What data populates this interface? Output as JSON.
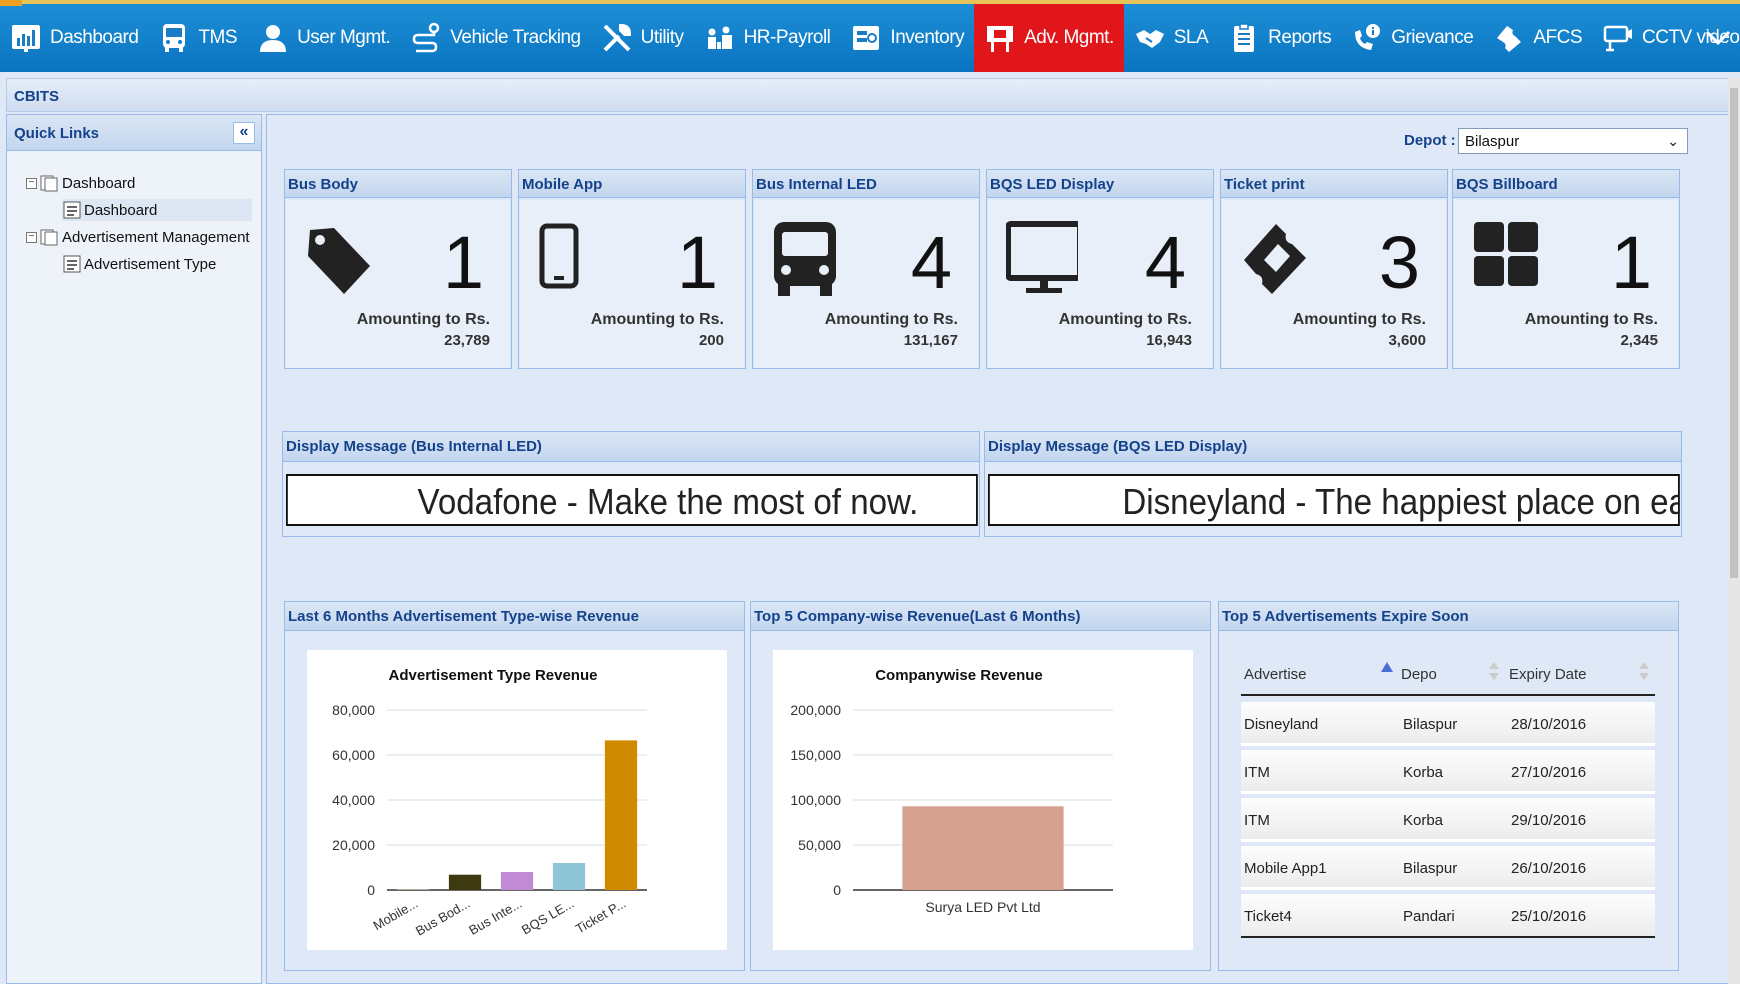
{
  "nav": [
    {
      "label": "Dashboard",
      "icon": "chart-icon"
    },
    {
      "label": "TMS",
      "icon": "bus-icon"
    },
    {
      "label": "User Mgmt.",
      "icon": "user-icon"
    },
    {
      "label": "Vehicle Tracking",
      "icon": "route-icon"
    },
    {
      "label": "Utility",
      "icon": "tools-icon"
    },
    {
      "label": "HR-Payroll",
      "icon": "people-icon"
    },
    {
      "label": "Inventory",
      "icon": "inventory-icon"
    },
    {
      "label": "Adv. Mgmt.",
      "icon": "billboard-icon"
    },
    {
      "label": "SLA",
      "icon": "handshake-icon"
    },
    {
      "label": "Reports",
      "icon": "clipboard-icon"
    },
    {
      "label": "Grievance",
      "icon": "phone-info-icon"
    },
    {
      "label": "AFCS",
      "icon": "ticket-icon"
    },
    {
      "label": "CCTV video",
      "icon": "cctv-icon"
    }
  ],
  "active_nav": "Adv. Mgmt.",
  "breadcrumb": "CBITS",
  "sidebar": {
    "title": "Quick Links",
    "tree": [
      {
        "label": "Dashboard",
        "children": [
          "Dashboard"
        ]
      },
      {
        "label": "Advertisement Management",
        "children": [
          "Advertisement Type"
        ]
      }
    ]
  },
  "depot": {
    "label": "Depot :",
    "value": "Bilaspur"
  },
  "cards": [
    {
      "title": "Bus Body",
      "icon": "tag-icon",
      "count": "1",
      "amount_label": "Amounting to Rs.",
      "amount": "23,789"
    },
    {
      "title": "Mobile App",
      "icon": "mobile-icon",
      "count": "1",
      "amount_label": "Amounting to Rs.",
      "amount": "200"
    },
    {
      "title": "Bus Internal LED",
      "icon": "bus-front-icon",
      "count": "4",
      "amount_label": "Amounting to Rs.",
      "amount": "131,167"
    },
    {
      "title": "BQS LED Display",
      "icon": "monitor-icon",
      "count": "4",
      "amount_label": "Amounting to Rs.",
      "amount": "16,943"
    },
    {
      "title": "Ticket print",
      "icon": "ticket-icon",
      "count": "3",
      "amount_label": "Amounting to Rs.",
      "amount": "3,600"
    },
    {
      "title": "BQS Billboard",
      "icon": "grid-icon",
      "count": "1",
      "amount_label": "Amounting to Rs.",
      "amount": "2,345"
    }
  ],
  "messages": [
    {
      "title": "Display Message (Bus Internal LED)",
      "text": "Vodafone - Make the most of now."
    },
    {
      "title": "Display Message (BQS LED Display)",
      "text": "Disneyland - The happiest place on ear"
    }
  ],
  "panels": {
    "revenue_title": "Last 6 Months Advertisement Type-wise Revenue",
    "company_title": "Top 5 Company-wise Revenue(Last 6 Months)",
    "expire_title": "Top 5 Advertisements Expire Soon"
  },
  "chart_data": [
    {
      "type": "bar",
      "title": "Advertisement Type Revenue",
      "categories": [
        "Mobile...",
        "Bus Bod...",
        "Bus Inte...",
        "BQS LE...",
        "Ticket P..."
      ],
      "values": [
        200,
        6800,
        8000,
        12000,
        66500
      ],
      "colors": [
        "#d6d5b3",
        "#3d3a10",
        "#c08ad4",
        "#8ec6d8",
        "#d08a00"
      ],
      "ylim": [
        0,
        80000
      ],
      "yticks": [
        "80,000",
        "60,000",
        "40,000",
        "20,000",
        "0"
      ],
      "grid": true
    },
    {
      "type": "bar",
      "title": "Companywise Revenue",
      "categories": [
        "Surya LED Pvt Ltd"
      ],
      "values": [
        93000
      ],
      "colors": [
        "#d6a08e"
      ],
      "ylim": [
        0,
        200000
      ],
      "yticks": [
        "200,000",
        "150,000",
        "100,000",
        "50,000",
        "0"
      ],
      "grid": true
    }
  ],
  "table": {
    "headers": [
      "Advertise",
      "Depo",
      "Expiry Date"
    ],
    "rows": [
      [
        "Disneyland",
        "Bilaspur",
        "28/10/2016"
      ],
      [
        "ITM",
        "Korba",
        "27/10/2016"
      ],
      [
        "ITM",
        "Korba",
        "29/10/2016"
      ],
      [
        "Mobile App1",
        "Bilaspur",
        "26/10/2016"
      ],
      [
        "Ticket4",
        "Pandari",
        "25/10/2016"
      ]
    ]
  }
}
